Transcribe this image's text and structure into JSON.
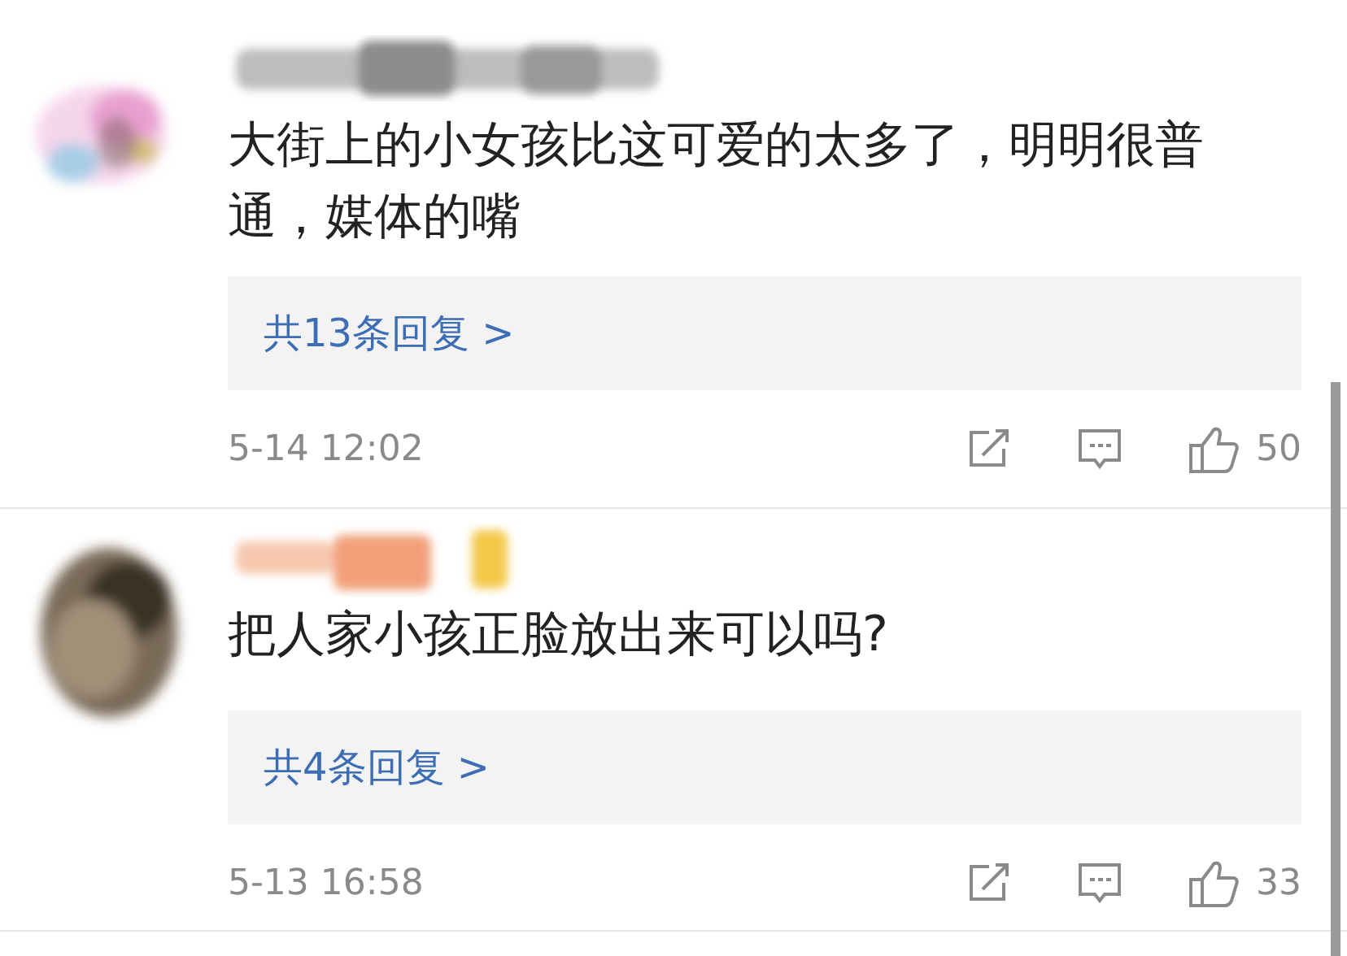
{
  "comments": [
    {
      "text": "大街上的小女孩比这可爱的太多了，明明很普通，媒体的嘴",
      "replies": "共13条回复 >",
      "time": "5-14 12:02",
      "likes": "50"
    },
    {
      "text": "把人家小孩正脸放出来可以吗?",
      "replies": "共4条回复 >",
      "time": "5-13 16:58",
      "likes": "33"
    }
  ]
}
